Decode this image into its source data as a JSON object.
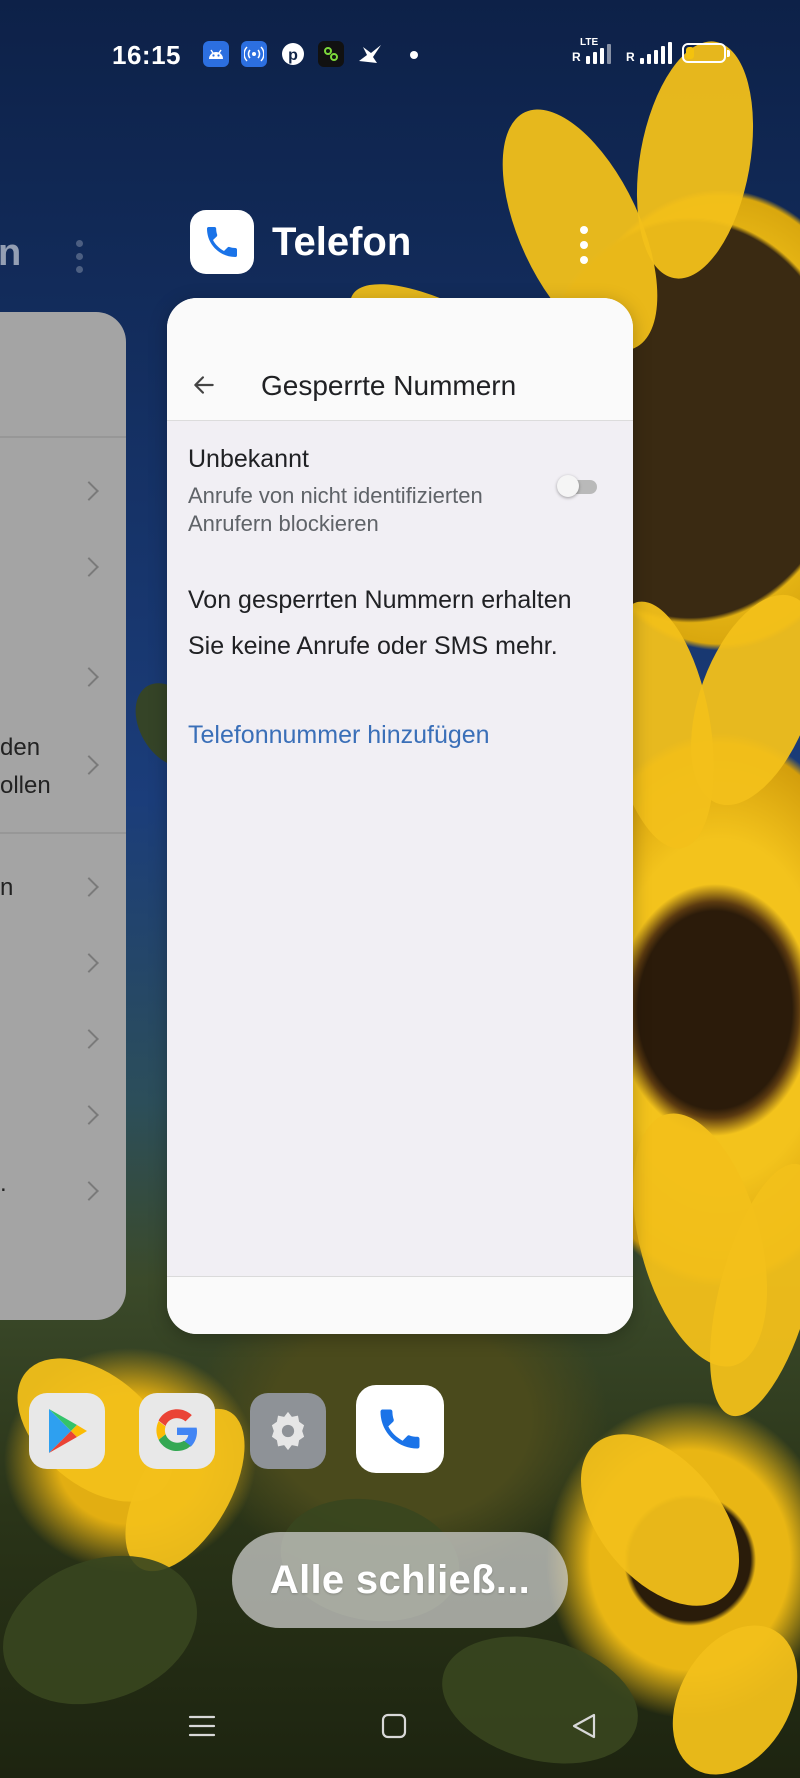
{
  "status_bar": {
    "time": "16:15",
    "notification_icons": [
      "android-icon",
      "hotspot-icon",
      "pinterest-icon",
      "app-icon",
      "bird-icon"
    ],
    "network_label": "LTE",
    "sim1_label": "R",
    "sim2_label": "R",
    "battery_level": 0.15
  },
  "app_header": {
    "title": "Telefon",
    "icon": "phone-icon"
  },
  "left_card": {
    "header_fragment": "n",
    "text_fragments": [
      "den",
      "ollen",
      "n",
      "."
    ]
  },
  "screen": {
    "title": "Gesperrte Nummern",
    "unknown": {
      "title": "Unbekannt",
      "description": "Anrufe von nicht identifizierten Anrufern blockieren",
      "enabled": false
    },
    "info": "Von gesperrten Nummern erhalten Sie keine Anrufe oder SMS mehr.",
    "add_link": "Telefonnummer hinzufügen"
  },
  "dock": {
    "apps": [
      "play-store-icon",
      "google-icon",
      "settings-icon",
      "phone-icon"
    ],
    "selected": "phone-icon"
  },
  "close_all_label": "Alle schließ...",
  "colors": {
    "link": "#3a6fb8",
    "battery": "#f4c20d",
    "phone_blue": "#1a73e8"
  }
}
